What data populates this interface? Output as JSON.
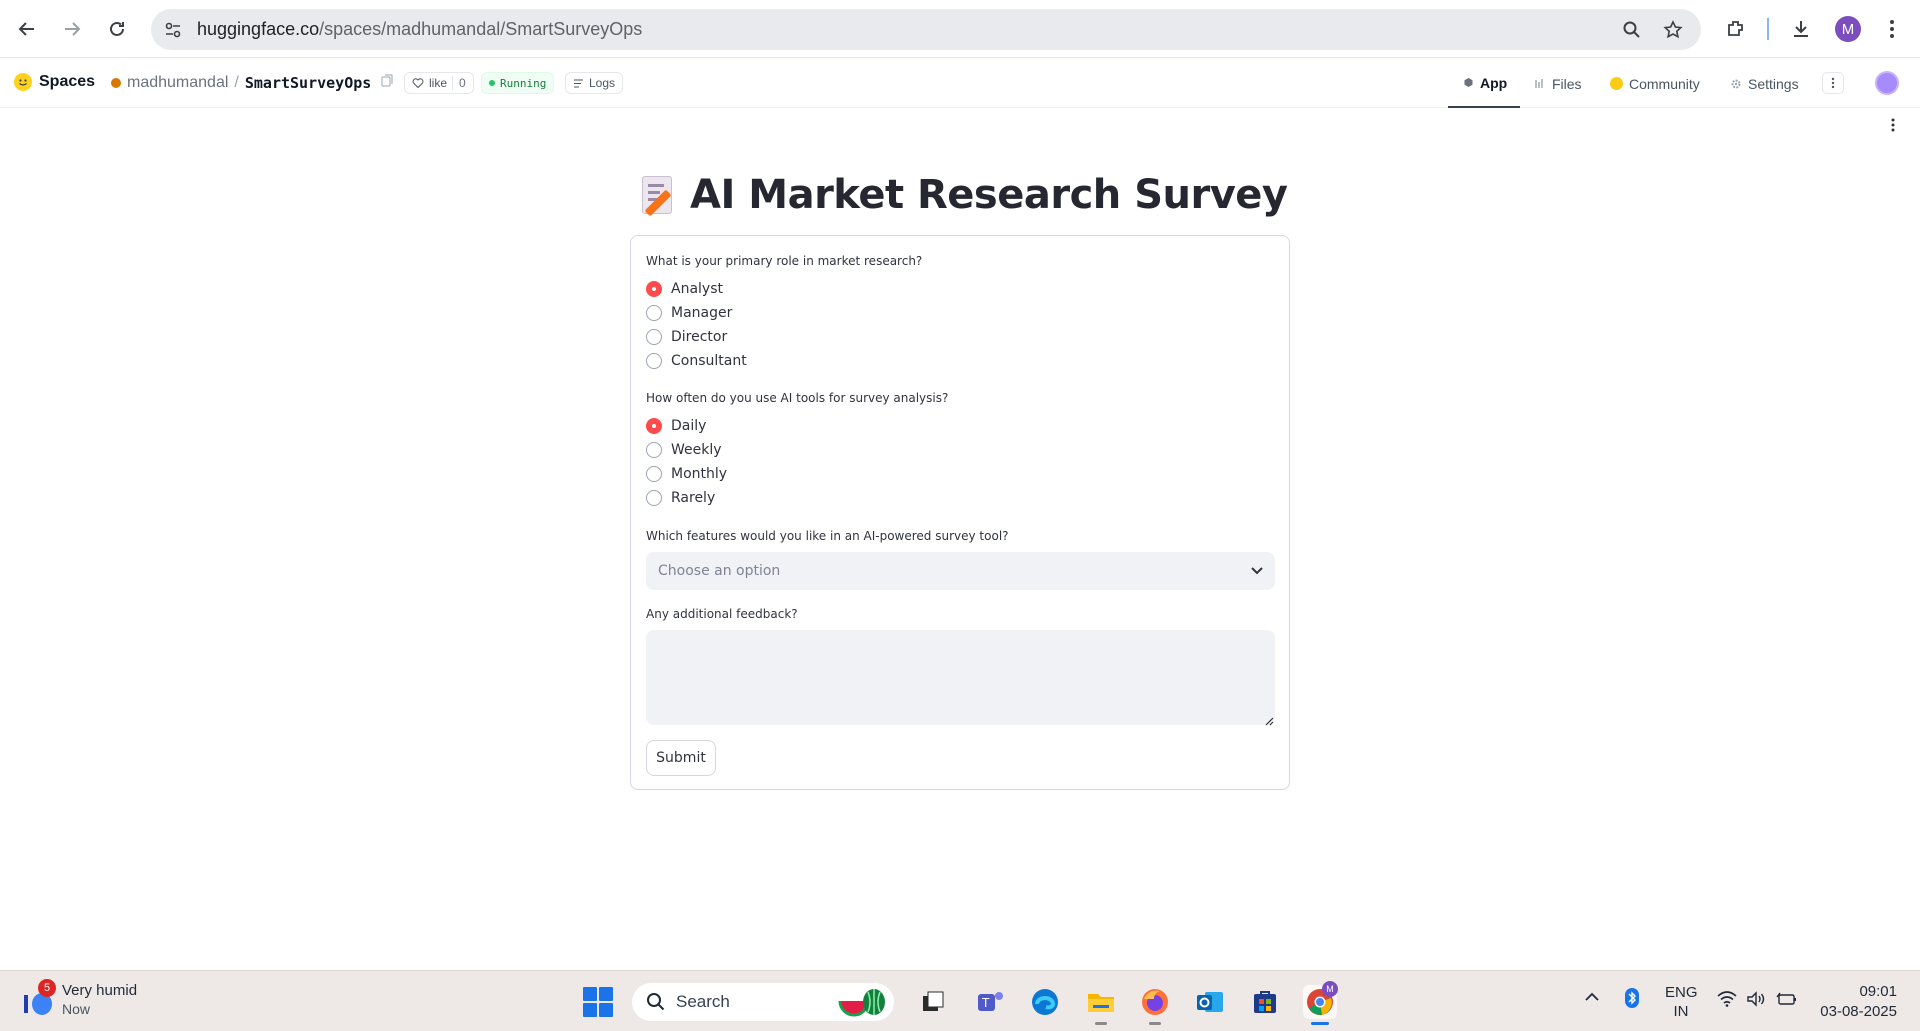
{
  "browser": {
    "url_host": "huggingface.co",
    "url_path": "/spaces/madhumandal/SmartSurveyOps",
    "profile_initial": "M"
  },
  "hf_header": {
    "brand": "Spaces",
    "owner": "madhumandal",
    "separator": "/",
    "space_name": "SmartSurveyOps",
    "like_label": "like",
    "like_count": "0",
    "status": "Running",
    "logs_label": "Logs",
    "tabs": [
      {
        "label": "App",
        "active": true
      },
      {
        "label": "Files",
        "active": false
      },
      {
        "label": "Community",
        "active": false
      },
      {
        "label": "Settings",
        "active": false
      }
    ]
  },
  "app": {
    "title": "AI Market Research Survey",
    "q1": {
      "label": "What is your primary role in market research?",
      "options": [
        "Analyst",
        "Manager",
        "Director",
        "Consultant"
      ],
      "selected": "Analyst"
    },
    "q2": {
      "label": "How often do you use AI tools for survey analysis?",
      "options": [
        "Daily",
        "Weekly",
        "Monthly",
        "Rarely"
      ],
      "selected": "Daily"
    },
    "q3": {
      "label": "Which features would you like in an AI-powered survey tool?",
      "placeholder": "Choose an option"
    },
    "q4": {
      "label": "Any additional feedback?",
      "value": ""
    },
    "submit_label": "Submit",
    "accent_color": "#ff4b4b"
  },
  "taskbar": {
    "weather_badge": "5",
    "weather_title": "Very humid",
    "weather_sub": "Now",
    "search_label": "Search",
    "lang_top": "ENG",
    "lang_bottom": "IN",
    "time": "09:01",
    "date": "03-08-2025",
    "chrome_badge": "M"
  }
}
